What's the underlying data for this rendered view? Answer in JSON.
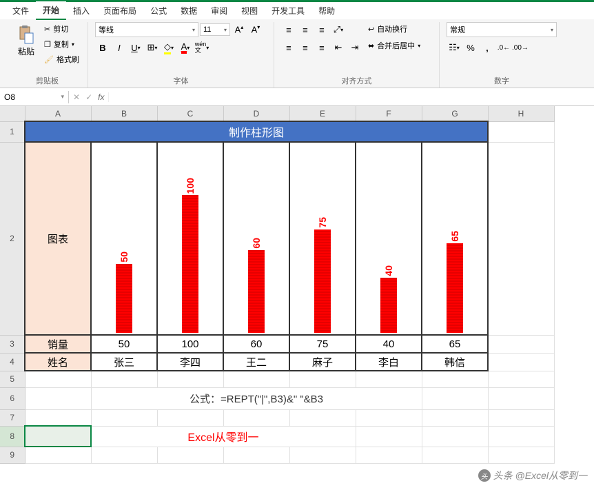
{
  "menu": {
    "items": [
      "文件",
      "开始",
      "插入",
      "页面布局",
      "公式",
      "数据",
      "审阅",
      "视图",
      "开发工具",
      "帮助"
    ],
    "active_index": 1
  },
  "ribbon": {
    "clipboard": {
      "paste": "粘贴",
      "cut": "剪切",
      "copy": "复制",
      "format_painter": "格式刷",
      "label": "剪贴板"
    },
    "font": {
      "name": "等线",
      "size": "11",
      "bold": "B",
      "italic": "I",
      "underline": "U",
      "wen": "wén",
      "label": "字体"
    },
    "alignment": {
      "wrap": "自动换行",
      "merge": "合并后居中",
      "label": "对齐方式"
    },
    "number": {
      "format": "常规",
      "label": "数字"
    }
  },
  "formula_bar": {
    "name_box": "O8",
    "fx": "fx",
    "formula": ""
  },
  "columns": [
    "A",
    "B",
    "C",
    "D",
    "E",
    "F",
    "G",
    "H"
  ],
  "rows": [
    "1",
    "2",
    "3",
    "4",
    "5",
    "6",
    "7",
    "8",
    "9"
  ],
  "sheet": {
    "title": "制作柱形图",
    "chart_label": "图表",
    "sales_label": "销量",
    "name_label": "姓名",
    "names": [
      "张三",
      "李四",
      "王二",
      "麻子",
      "李白",
      "韩信"
    ],
    "values": [
      "50",
      "100",
      "60",
      "75",
      "40",
      "65"
    ],
    "formula_line": "公式：=REPT(\"|\",B3)&\"  \"&B3",
    "credit": "Excel从零到一"
  },
  "chart_data": {
    "type": "bar",
    "title": "制作柱形图",
    "categories": [
      "张三",
      "李四",
      "王二",
      "麻子",
      "李白",
      "韩信"
    ],
    "values": [
      50,
      100,
      60,
      75,
      40,
      65
    ],
    "xlabel": "姓名",
    "ylabel": "销量",
    "ylim": [
      0,
      100
    ]
  },
  "watermark": "头条 @Excel从零到一"
}
